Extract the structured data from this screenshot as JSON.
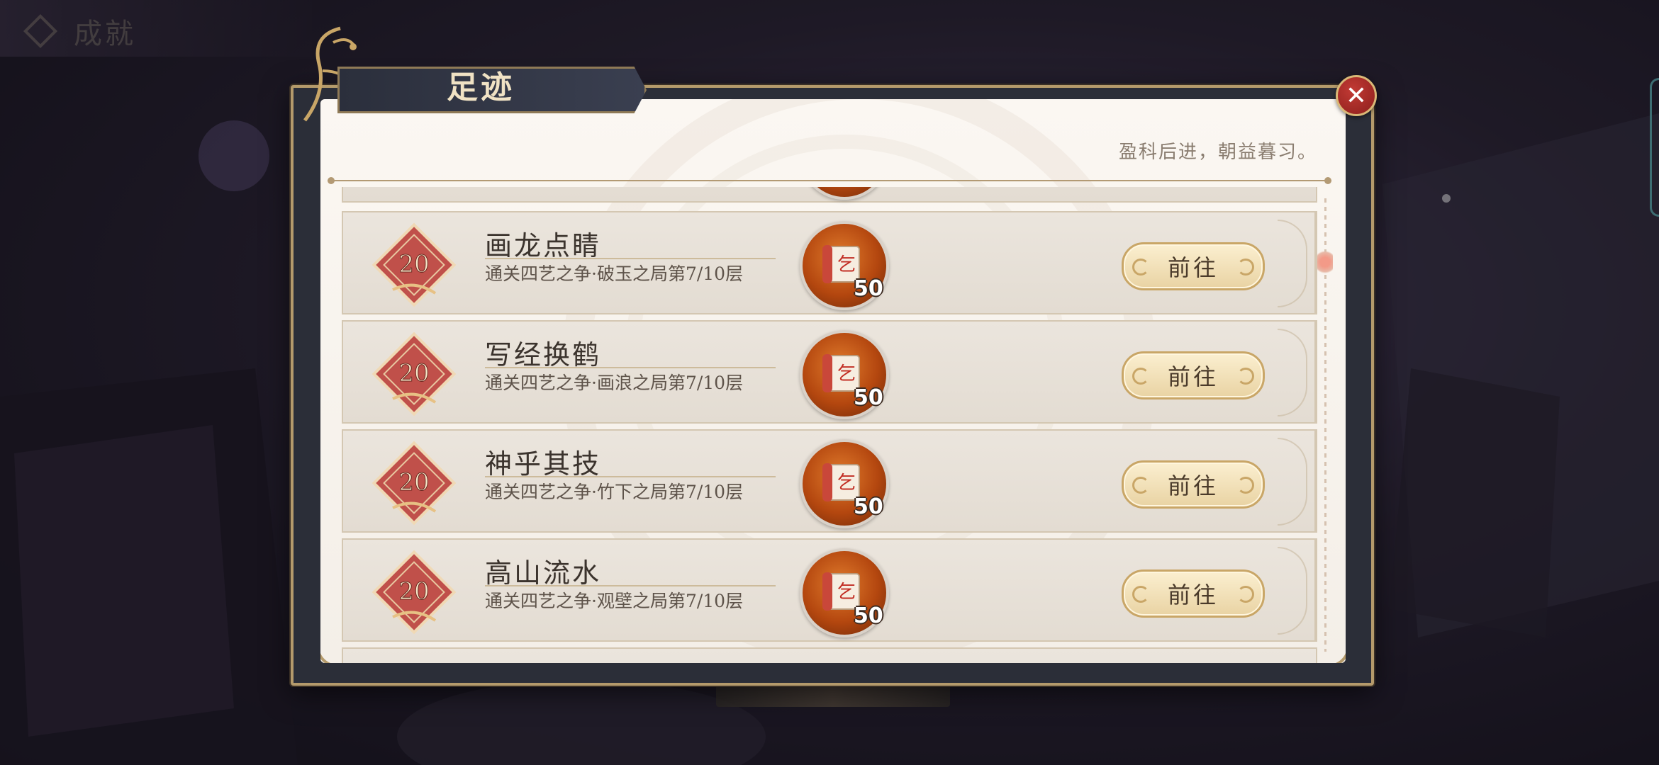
{
  "background": {
    "top_label": "成就"
  },
  "dialog": {
    "title": "足迹",
    "subtitle": "盈科后进，朝益暮习。",
    "close_icon": "close-icon",
    "go_label": "前往",
    "rows": [
      {
        "badge_value": "20",
        "title": "画龙点睛",
        "description": "通关四艺之争·破玉之局第7/10层",
        "reward_icon": "scroll-icon",
        "reward_count": "50",
        "button": "前往"
      },
      {
        "badge_value": "20",
        "title": "写经换鹤",
        "description": "通关四艺之争·画浪之局第7/10层",
        "reward_icon": "scroll-icon",
        "reward_count": "50",
        "button": "前往"
      },
      {
        "badge_value": "20",
        "title": "神乎其技",
        "description": "通关四艺之争·竹下之局第7/10层",
        "reward_icon": "scroll-icon",
        "reward_count": "50",
        "button": "前往"
      },
      {
        "badge_value": "20",
        "title": "高山流水",
        "description": "通关四艺之争·观壁之局第7/10层",
        "reward_icon": "scroll-icon",
        "reward_count": "50",
        "button": "前往"
      }
    ]
  },
  "colors": {
    "accent_gold": "#b49a6b",
    "close_red": "#c23a34",
    "reward_orange": "#b4470f",
    "badge_red": "#c0504a"
  }
}
